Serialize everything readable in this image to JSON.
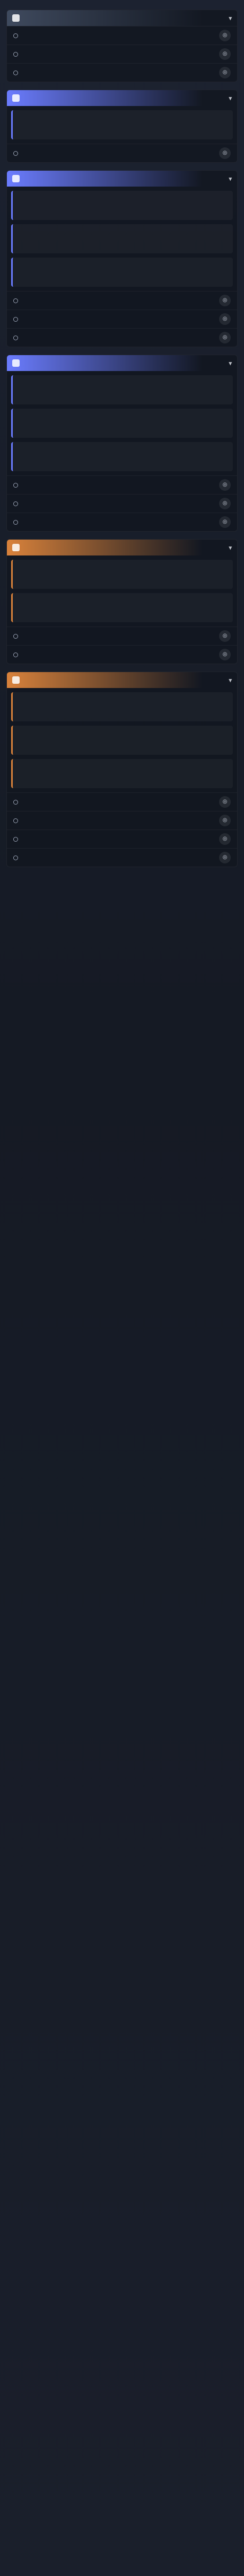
{
  "sections": [
    {
      "accent": "#3f4a5e",
      "title": "",
      "cards": [],
      "rows": [
        {
          "label": "",
          "distance": ""
        },
        {
          "label": "",
          "distance": ""
        },
        {
          "label": "",
          "distance": ""
        }
      ]
    },
    {
      "accent": "#6b7cff",
      "title": "",
      "cards": [
        {
          "title": "",
          "sub": ""
        }
      ],
      "rows": [
        {
          "label": "",
          "distance": ""
        }
      ]
    },
    {
      "accent": "#6b7cff",
      "title": "",
      "cards": [
        {
          "title": "",
          "sub": ""
        },
        {
          "title": "",
          "sub": ""
        },
        {
          "title": "",
          "sub": ""
        }
      ],
      "rows": [
        {
          "label": "",
          "distance": ""
        },
        {
          "label": "",
          "distance": ""
        },
        {
          "label": "",
          "distance": ""
        }
      ]
    },
    {
      "accent": "#6b7cff",
      "title": "",
      "cards": [
        {
          "title": "",
          "sub": ""
        },
        {
          "title": "",
          "sub": ""
        },
        {
          "title": "",
          "sub": ""
        }
      ],
      "rows": [
        {
          "label": "",
          "distance": ""
        },
        {
          "label": "",
          "distance": ""
        },
        {
          "label": "",
          "distance": ""
        }
      ]
    },
    {
      "accent": "#d9823b",
      "title": "",
      "cards": [
        {
          "title": "",
          "sub": ""
        },
        {
          "title": "",
          "sub": ""
        }
      ],
      "rows": [
        {
          "label": "",
          "distance": ""
        },
        {
          "label": "",
          "distance": ""
        }
      ]
    },
    {
      "accent": "#d9823b",
      "title": "",
      "cards": [
        {
          "title": "",
          "sub": ""
        },
        {
          "title": "",
          "sub": ""
        },
        {
          "title": "",
          "sub": ""
        }
      ],
      "rows": [
        {
          "label": "",
          "distance": ""
        },
        {
          "label": "",
          "distance": ""
        },
        {
          "label": "",
          "distance": ""
        },
        {
          "label": "",
          "distance": ""
        }
      ]
    }
  ]
}
